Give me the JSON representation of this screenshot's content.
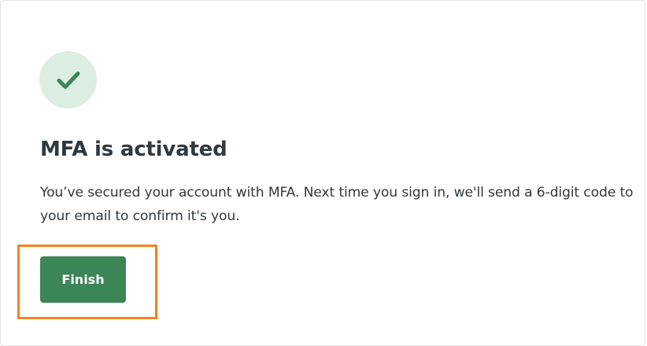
{
  "dialog": {
    "status_icon": "checkmark-icon",
    "title": "MFA is activated",
    "description": "You’ve secured your account with MFA. Next time you sign in, we'll send a 6-digit code to your email to confirm it's you.",
    "finish_label": "Finish"
  },
  "colors": {
    "accent_green": "#3c8556",
    "badge_background": "#dcede2",
    "highlight_orange": "#f5821f",
    "text": "#2f3941"
  }
}
